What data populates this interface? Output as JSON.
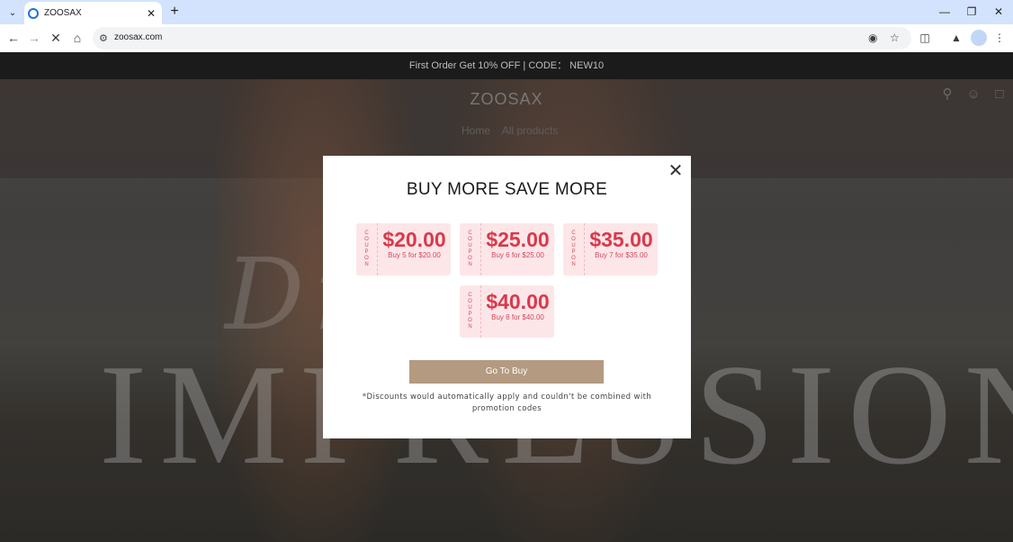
{
  "browser": {
    "tab_title": "ZOOSAX",
    "url": "zoosax.com"
  },
  "site": {
    "announcement": "First Order Get 10% OFF | CODE： NEW10",
    "logo": "ZOOSAX",
    "breadcrumbs": [
      "Home",
      "All products"
    ],
    "hero_script": "Dream",
    "hero_big": "IMPRESSIONS"
  },
  "modal": {
    "title": "BUY MORE SAVE MORE",
    "coupon_label": [
      "C",
      "O",
      "U",
      "P",
      "O",
      "N"
    ],
    "coupons": [
      {
        "amount": "$20.00",
        "desc": "Buy 5 for $20.00"
      },
      {
        "amount": "$25.00",
        "desc": "Buy 6 for $25.00"
      },
      {
        "amount": "$35.00",
        "desc": "Buy 7 for $35.00"
      },
      {
        "amount": "$40.00",
        "desc": "Buy 8 for $40.00"
      }
    ],
    "button": "Go To Buy",
    "disclaimer": "*Discounts would automatically apply and couldn't be combined with promotion codes"
  },
  "colors": {
    "coupon_red": "#d9394c",
    "button": "#b39a80",
    "announce_bg": "#1b1b1b"
  }
}
